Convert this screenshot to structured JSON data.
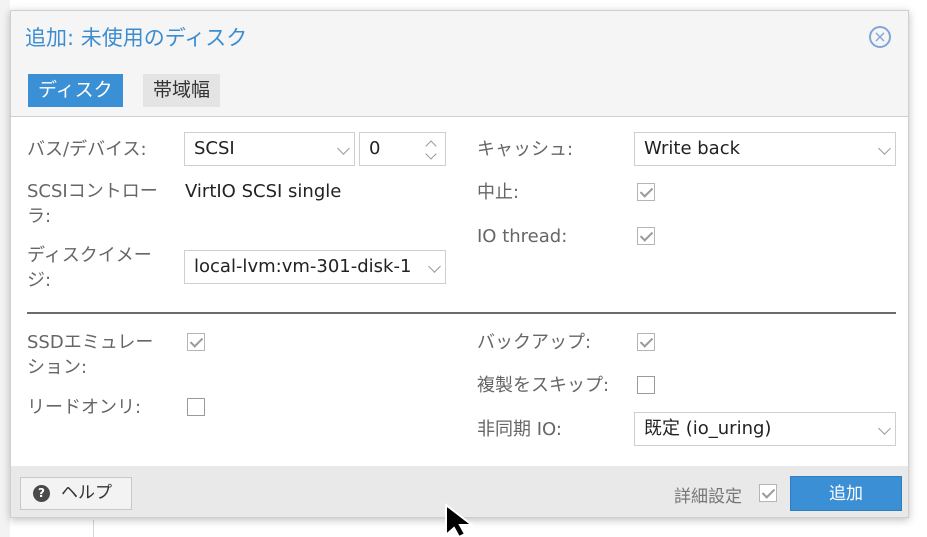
{
  "dialog": {
    "title": "追加: 未使用のディスク",
    "close_icon": "close-circle-icon"
  },
  "tabs": [
    {
      "label": "ディスク",
      "active": true
    },
    {
      "label": "帯域幅",
      "active": false
    }
  ],
  "form": {
    "bus_label": "バス/デバイス:",
    "bus_value": "SCSI",
    "device_index": "0",
    "controller_label": "SCSIコントロー\nラ:",
    "controller_value": "VirtIO SCSI single",
    "image_label": "ディスクイメー\nジ:",
    "image_value": "local-lvm:vm-301-disk-1",
    "cache_label": "キャッシュ:",
    "cache_value": "Write back",
    "discard_label": "中止:",
    "discard_checked": true,
    "iothread_label": "IO thread:",
    "iothread_checked": true,
    "ssd_label": "SSDエミュレー\nション:",
    "ssd_checked": true,
    "readonly_label": "リードオンリ:",
    "readonly_checked": false,
    "backup_label": "バックアップ:",
    "backup_checked": true,
    "skip_replication_label": "複製をスキップ:",
    "skip_replication_checked": false,
    "async_io_label": "非同期 IO:",
    "async_io_value": "既定 (io_uring)"
  },
  "footer": {
    "help_label": "ヘルプ",
    "help_icon": "question-circle-icon",
    "advanced_label": "詳細設定",
    "advanced_checked": true,
    "add_label": "追加"
  },
  "colors": {
    "accent": "#3b8fd4",
    "title": "#3c8dd0"
  }
}
